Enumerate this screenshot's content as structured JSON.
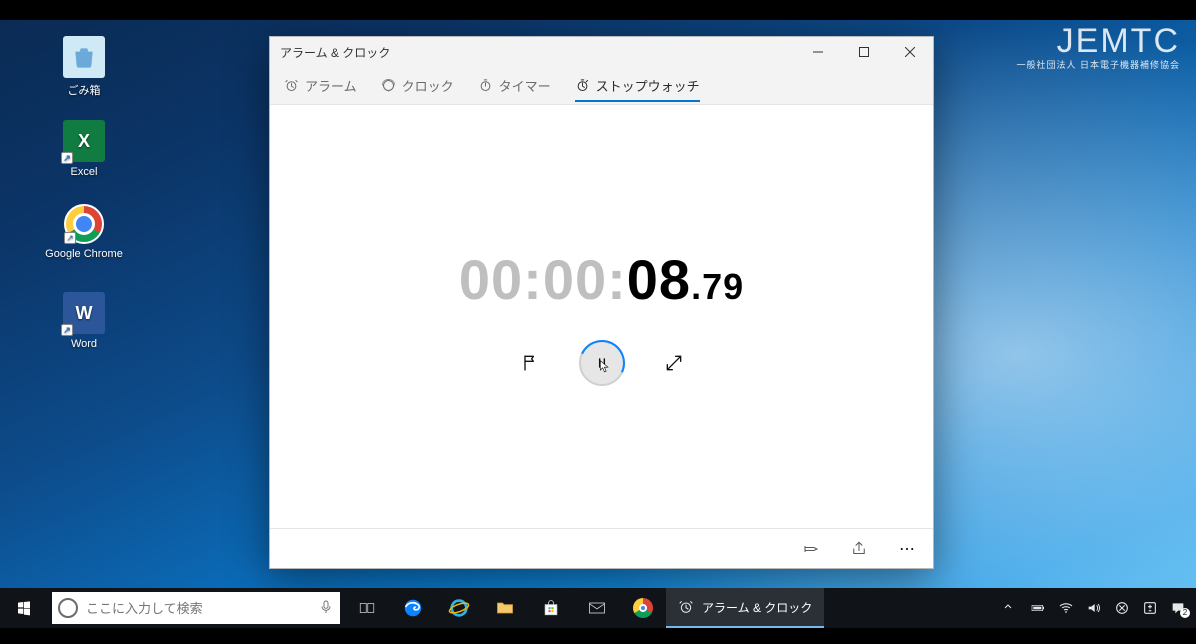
{
  "watermark": {
    "big": "JEMTC",
    "small": "一般社団法人 日本電子機器補修協会"
  },
  "desktop_icons": {
    "recycle": "ごみ箱",
    "excel": "Excel",
    "chrome": "Google Chrome",
    "word": "Word"
  },
  "window": {
    "title": "アラーム & クロック",
    "tabs": {
      "alarm": "アラーム",
      "clock": "クロック",
      "timer": "タイマー",
      "stopwatch": "ストップウォッチ"
    },
    "time": {
      "h": "00",
      "m": "00",
      "s": "08",
      "frac": "79"
    }
  },
  "taskbar": {
    "search_placeholder": "ここに入力して検索",
    "app_label": "アラーム & クロック",
    "notification_count": "2"
  }
}
